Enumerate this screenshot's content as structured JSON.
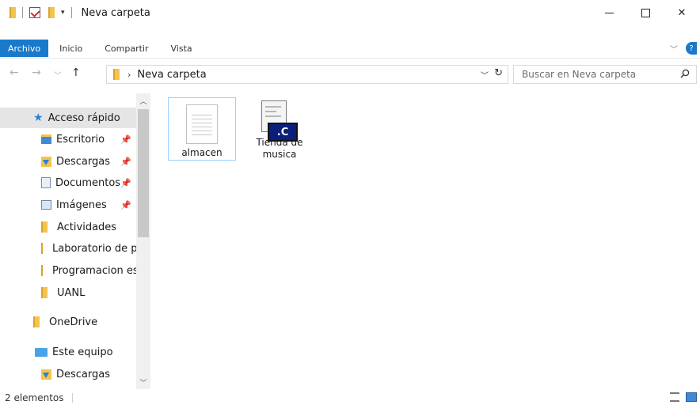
{
  "window": {
    "title": "Neva carpeta",
    "close_glyph": "✕"
  },
  "ribbon": {
    "tabs": [
      {
        "label": "Archivo"
      },
      {
        "label": "Inicio"
      },
      {
        "label": "Compartir"
      },
      {
        "label": "Vista"
      }
    ],
    "help_glyph": "?"
  },
  "address": {
    "crumb": "Neva carpeta",
    "search_placeholder": "Buscar en Neva carpeta"
  },
  "sidebar": {
    "items": [
      {
        "label": "Acceso rápido",
        "icon": "star-icon"
      },
      {
        "label": "Escritorio",
        "icon": "desktop-icon",
        "pinned": true
      },
      {
        "label": "Descargas",
        "icon": "downloads-icon",
        "pinned": true
      },
      {
        "label": "Documentos",
        "icon": "documents-icon",
        "pinned": true
      },
      {
        "label": "Imágenes",
        "icon": "pictures-icon",
        "pinned": true
      },
      {
        "label": "Actividades",
        "icon": "folder-icon"
      },
      {
        "label": "Laboratorio de p",
        "icon": "folder-icon"
      },
      {
        "label": "Programacion es",
        "icon": "folder-icon"
      },
      {
        "label": "UANL",
        "icon": "folder-icon"
      },
      {
        "label": "OneDrive",
        "icon": "onedrive-icon"
      },
      {
        "label": "Este equipo",
        "icon": "computer-icon"
      },
      {
        "label": "Descargas",
        "icon": "downloads-icon"
      }
    ]
  },
  "files": [
    {
      "label": "almacen",
      "icon": "text-file-icon",
      "selected": true
    },
    {
      "label": "Tienda de musica",
      "icon": "c-source-file-icon",
      "selected": false
    }
  ],
  "status": {
    "count": "2 elementos"
  }
}
